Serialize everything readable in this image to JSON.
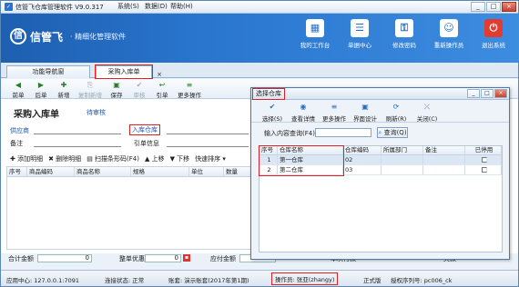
{
  "window": {
    "title": "信管飞仓库管理软件 V9.0.317",
    "menus": [
      "系统(S)",
      "数据(D)",
      "帮助(H)"
    ],
    "min": "_",
    "max": "□",
    "close": "×"
  },
  "banner": {
    "logo_mark": "信",
    "brand": "信管飞",
    "slogan": "· 精细化管理软件",
    "tools": [
      {
        "label": "我的工作台",
        "icon": "▦"
      },
      {
        "label": "单据中心",
        "icon": "☰"
      },
      {
        "label": "修改密码",
        "icon": "⚿"
      },
      {
        "label": "重新操作员",
        "icon": "☺"
      },
      {
        "label": "退出系统",
        "icon": "⏻"
      }
    ]
  },
  "tabs": [
    {
      "label": "功能导航窗"
    },
    {
      "label": "采购入库单",
      "close": "×"
    }
  ],
  "toolbar": [
    {
      "label": "前单",
      "icon": "◀",
      "disabled": false
    },
    {
      "label": "后单",
      "icon": "▶",
      "disabled": false
    },
    {
      "label": "新增",
      "icon": "✚",
      "disabled": false
    },
    {
      "label": "复制新增",
      "icon": "⎘",
      "disabled": true
    },
    {
      "label": "保存",
      "icon": "▣",
      "disabled": false
    },
    {
      "label": "审核",
      "icon": "✔",
      "disabled": true
    },
    {
      "label": "引单",
      "icon": "↩",
      "disabled": false
    },
    {
      "label": "更多操作",
      "icon": "≡",
      "disabled": false
    }
  ],
  "form": {
    "title": "采购入库单",
    "status": "待审核",
    "supplier_label": "供应商",
    "warehouse_label": "入库仓库",
    "note_label": "备注",
    "ref_label": "引单信息"
  },
  "detail_toolbar": [
    "✚ 添加明细",
    "✖ 删除明细",
    "▤ 扫描条形码(F4)",
    "▲ 上移",
    "▼ 下移",
    "快速排序 ▾"
  ],
  "detail_columns": [
    "序号",
    "商品编码",
    "商品名称",
    "规格",
    "单位",
    "数量"
  ],
  "totals": {
    "total_label": "合计金额",
    "total_value": "0",
    "discount_label": "整单优惠",
    "discount_value": "0",
    "payable_label": "应付金额",
    "payable_value": "0",
    "paid_label": "本次付款",
    "debt_label": "欠款"
  },
  "statusbar": {
    "server": "应用中心: 127.0.0.1:7091",
    "conn": "连接状态: 正常",
    "account": "账套: 演示账套(2017年第1期)",
    "operator": "操作员: 张亚(zhangy)",
    "edition": "正式版",
    "serial": "授权序列号: pc006_ck"
  },
  "dialog": {
    "title": "选择仓库",
    "buttons": [
      {
        "label": "选择(S)",
        "icon": "✔"
      },
      {
        "label": "查看详情",
        "icon": "◉"
      },
      {
        "label": "更多操作",
        "icon": "≡"
      },
      {
        "label": "界面设计",
        "icon": "▣"
      },
      {
        "label": "刷新(R)",
        "icon": "⟳"
      },
      {
        "label": "关闭(C)",
        "icon": "⤫"
      }
    ],
    "query_label": "输入内容查询(F4):",
    "query_value": "",
    "query_button": "查询(Q)",
    "columns": [
      "序号",
      "仓库名称",
      "仓库编码",
      "所属部门",
      "备注",
      "已停用"
    ],
    "rows": [
      {
        "no": "1",
        "name": "第一仓库",
        "code": "02",
        "dept": "",
        "note": "",
        "disabled": false
      },
      {
        "no": "2",
        "name": "第二仓库",
        "code": "03",
        "dept": "",
        "note": "",
        "disabled": false
      }
    ]
  }
}
